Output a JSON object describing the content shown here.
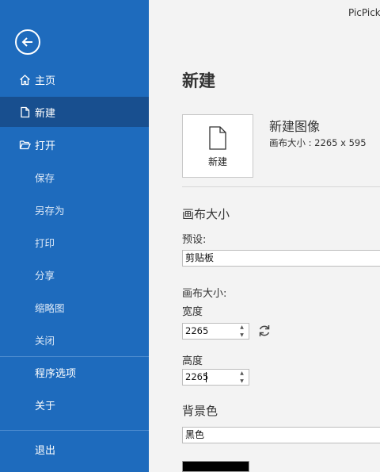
{
  "app": {
    "title": "PicPick"
  },
  "sidebar": {
    "items": [
      {
        "label": "主页",
        "icon": "home-icon"
      },
      {
        "label": "新建",
        "icon": "file-icon"
      },
      {
        "label": "打开",
        "icon": "folder-open-icon"
      },
      {
        "label": "保存"
      },
      {
        "label": "另存为"
      },
      {
        "label": "打印"
      },
      {
        "label": "分享"
      },
      {
        "label": "缩略图"
      },
      {
        "label": "关闭"
      },
      {
        "label": "程序选项"
      },
      {
        "label": "关于"
      },
      {
        "label": "退出"
      }
    ],
    "active_index": 1
  },
  "main": {
    "title": "新建",
    "new_tile": {
      "label": "新建"
    },
    "new_image": {
      "title": "新建图像",
      "size_text": "画布大小 : 2265 x 595"
    },
    "canvas_section": {
      "title": "画布大小"
    },
    "preset": {
      "label": "预设:",
      "value": "剪贴板"
    },
    "canvas_size": {
      "title": "画布大小:",
      "width_label": "宽度",
      "width_value": "2265",
      "height_label": "高度",
      "height_value": "2265"
    },
    "background": {
      "title": "背景色",
      "value": "黑色",
      "swatch_color": "#000000"
    }
  },
  "colors": {
    "sidebar": "#1e6bbd",
    "sidebar_active": "#184f8f",
    "page_bg": "#f3f3f3"
  }
}
